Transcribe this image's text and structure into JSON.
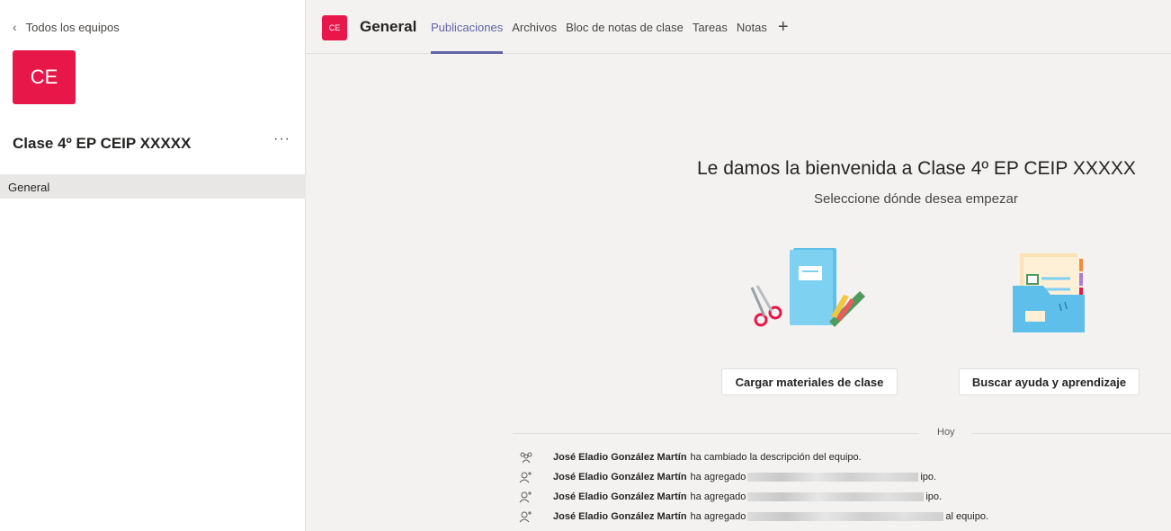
{
  "sidebar": {
    "back_label": "Todos los equipos",
    "team_initials": "CE",
    "team_name": "Clase 4º EP CEIP XXXXX",
    "more_label": "···",
    "channels": [
      {
        "label": "General"
      }
    ]
  },
  "header": {
    "channel_initials": "CE",
    "channel_title": "General",
    "tabs": [
      {
        "label": "Publicaciones",
        "active": true
      },
      {
        "label": "Archivos"
      },
      {
        "label": "Bloc de notas de clase"
      },
      {
        "label": "Tareas"
      },
      {
        "label": "Notas"
      }
    ],
    "add_tab_label": "+"
  },
  "welcome": {
    "title": "Le damos la bienvenida a Clase 4º EP CEIP XXXXX",
    "subtitle": "Seleccione dónde desea empezar",
    "button_upload": "Cargar materiales de clase",
    "button_help": "Buscar ayuda y aprendizaje"
  },
  "feed": {
    "day_label": "Hoy",
    "items": [
      {
        "icon": "team-icon",
        "user": "José Eladio González Martín",
        "action": "ha cambiado la descripción del equipo."
      },
      {
        "icon": "add-person-icon",
        "user": "José Eladio González Martín",
        "action": "ha agregado",
        "suffix": "ipo."
      },
      {
        "icon": "add-person-icon",
        "user": "José Eladio González Martín",
        "action": "ha agregado",
        "suffix": "ipo."
      },
      {
        "icon": "add-person-icon",
        "user": "José Eladio González Martín",
        "action": "ha agregado",
        "suffix": "al equipo."
      }
    ]
  },
  "colors": {
    "accent": "#6264a7",
    "team": "#e8174a"
  }
}
